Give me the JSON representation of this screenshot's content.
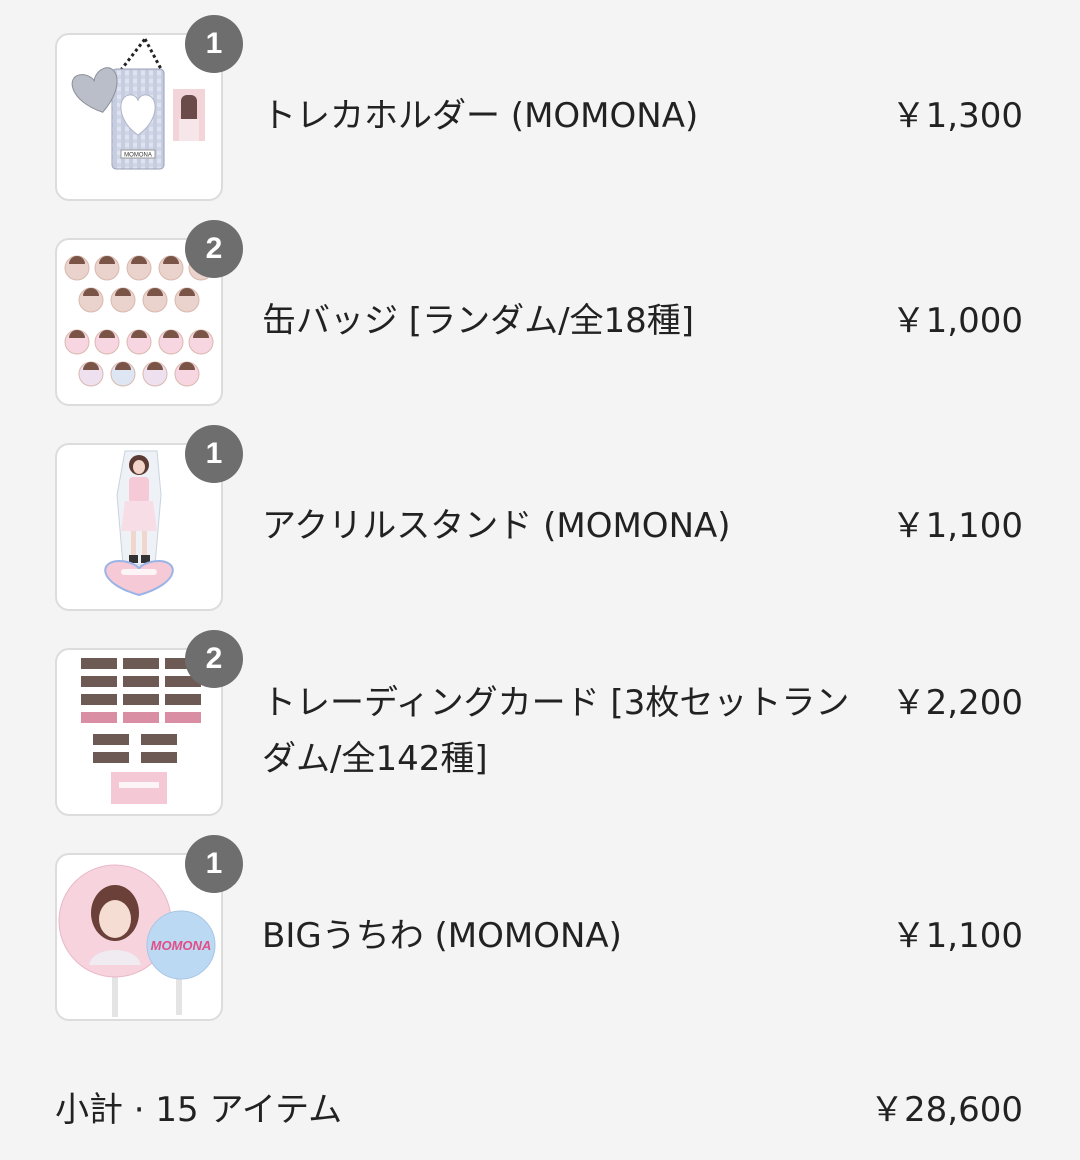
{
  "cart": {
    "items": [
      {
        "quantity": "1",
        "name": "トレカホルダー (MOMONA)",
        "price": "￥1,300",
        "image_icon": "card-holder-image",
        "image_caption": "MOMONA"
      },
      {
        "quantity": "2",
        "name": "缶バッジ [ランダム/全18種]",
        "price": "￥1,000",
        "image_icon": "can-badge-image"
      },
      {
        "quantity": "1",
        "name": "アクリルスタンド (MOMONA)",
        "price": "￥1,100",
        "image_icon": "acrylic-stand-image"
      },
      {
        "quantity": "2",
        "name": "トレーディングカード [3枚セットランダム/全142種]",
        "price": "￥2,200",
        "image_icon": "trading-card-image"
      },
      {
        "quantity": "1",
        "name": "BIGうちわ (MOMONA)",
        "price": "￥1,100",
        "image_icon": "big-fan-image",
        "image_caption": "MOMONA"
      }
    ],
    "subtotal_label": "小計 · 15 アイテム",
    "subtotal_value": "￥28,600"
  },
  "colors": {
    "background": "#f4f4f4",
    "badge": "#6e6e6e",
    "text": "#222222"
  }
}
